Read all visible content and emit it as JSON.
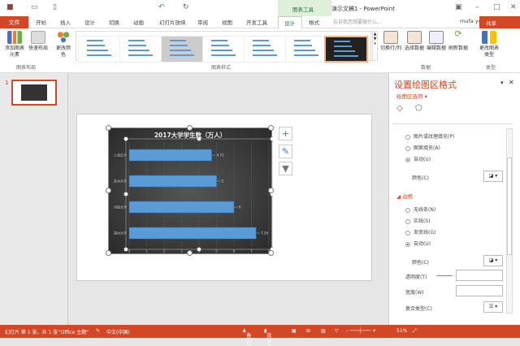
{
  "window": {
    "title": "演示文稿1 - PowerPoint",
    "context_tool": "图表工具",
    "user": "mufa yu",
    "share": "共享",
    "search_placeholder": "告诉我您想要做什么..."
  },
  "tabs": [
    "文件",
    "开始",
    "插入",
    "设计",
    "切换",
    "动画",
    "幻灯片放映",
    "审阅",
    "视图",
    "开发工具",
    "设计",
    "格式"
  ],
  "ribbon": {
    "buttons": {
      "add_element": "添加图表元素",
      "quick_layout": "快速布局",
      "change_color": "更改颜色",
      "switch_rowcol": "切换行/列",
      "select_data": "选择数据",
      "edit_data": "编辑数据",
      "refresh_data": "刷新数据",
      "change_type": "更改图表类型"
    },
    "groups": [
      "图表布局",
      "图表样式",
      "数据",
      "类型"
    ]
  },
  "slide_number": "1",
  "chart_data": {
    "type": "bar",
    "title": "2017大学学生数（万人）",
    "categories": [
      "上海交大",
      "苏州大学",
      "河南大学",
      "郑州大学"
    ],
    "values": [
      4.72,
      5,
      6,
      7.26
    ],
    "value_labels": [
      "4.72",
      "5",
      "6",
      "7.26"
    ],
    "xlim": [
      0,
      8
    ],
    "xticks": [
      "0",
      "1",
      "2",
      "3",
      "4",
      "5",
      "6",
      "7",
      "8"
    ],
    "grid": true,
    "bar_color": "#5b9bd5"
  },
  "pane": {
    "title": "设置绘图区格式",
    "subtitle": "绘图区选项",
    "fill_options": [
      "图片或纹理填充(P)",
      "图案填充(A)",
      "自动(U)"
    ],
    "fill_color_label": "颜色(C)",
    "border_heading": "边框",
    "border_options": [
      "无线条(N)",
      "实线(S)",
      "渐变线(G)",
      "自动(U)"
    ],
    "border_color_label": "颜色(C)",
    "transparency_label": "透明度(T)",
    "width_label": "宽度(W)",
    "compound_label": "复合类型(C)"
  },
  "status": {
    "slide": "幻灯片 第 1 张，共 1 张",
    "theme": "\"Office 主题\"",
    "lang": "中文(中国)",
    "notes": "备注",
    "comments": "批注",
    "zoom": "51%"
  },
  "colors": {
    "accent": "#d24726"
  }
}
